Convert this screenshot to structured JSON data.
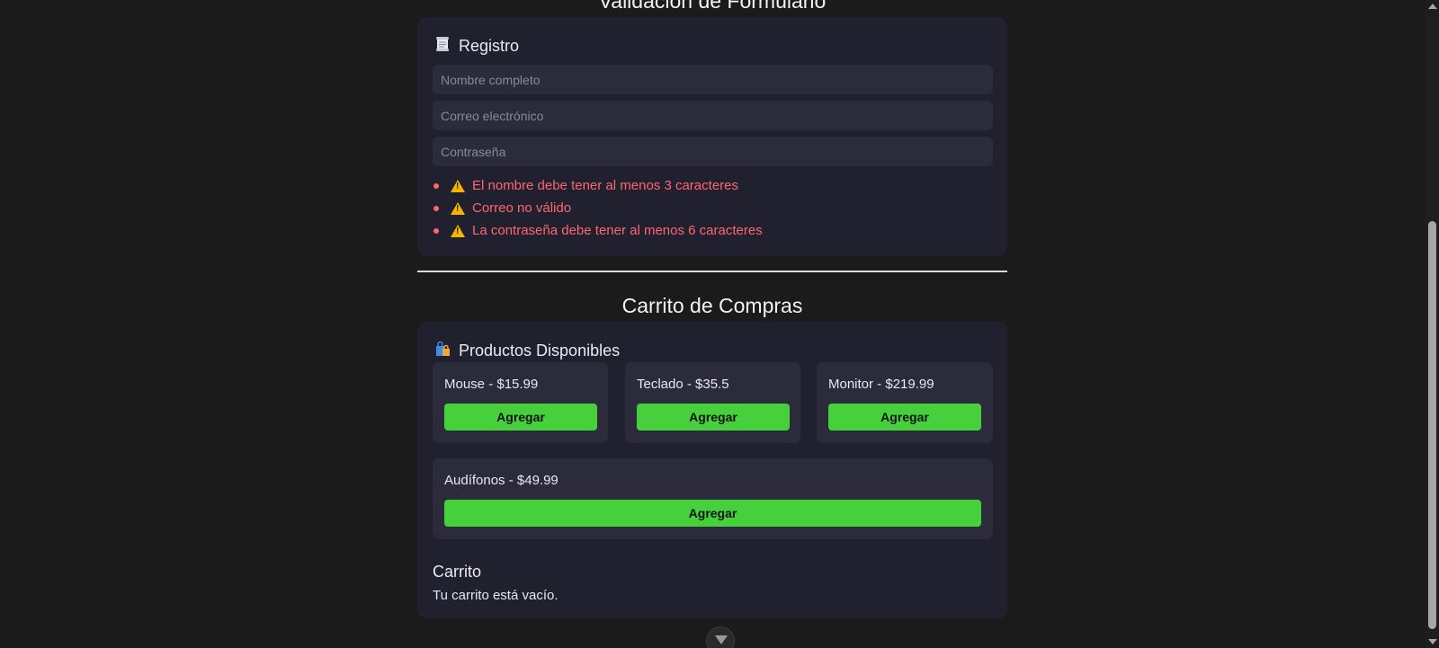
{
  "form_section": {
    "heading": "Validación de Formulario",
    "card_title": "Registro",
    "card_icon": "scroll-icon",
    "fields": {
      "name_placeholder": "Nombre completo",
      "email_placeholder": "Correo electrónico",
      "password_placeholder": "Contraseña"
    },
    "errors": [
      "El nombre debe tener al menos 3 caracteres",
      "Correo no válido",
      "La contraseña debe tener al menos 6 caracteres"
    ],
    "error_color": "#ff6670"
  },
  "cart_section": {
    "heading": "Carrito de Compras",
    "products_title": "Productos Disponibles",
    "products_icon": "shopping-bags-icon",
    "products": [
      {
        "label": "Mouse - $15.99",
        "button": "Agregar"
      },
      {
        "label": "Teclado - $35.5",
        "button": "Agregar"
      },
      {
        "label": "Monitor - $219.99",
        "button": "Agregar"
      },
      {
        "label": "Audífonos - $49.99",
        "button": "Agregar"
      }
    ],
    "cart_title": "Carrito",
    "cart_empty_text": "Tu carrito está vacío.",
    "button_color": "#46d13c"
  }
}
